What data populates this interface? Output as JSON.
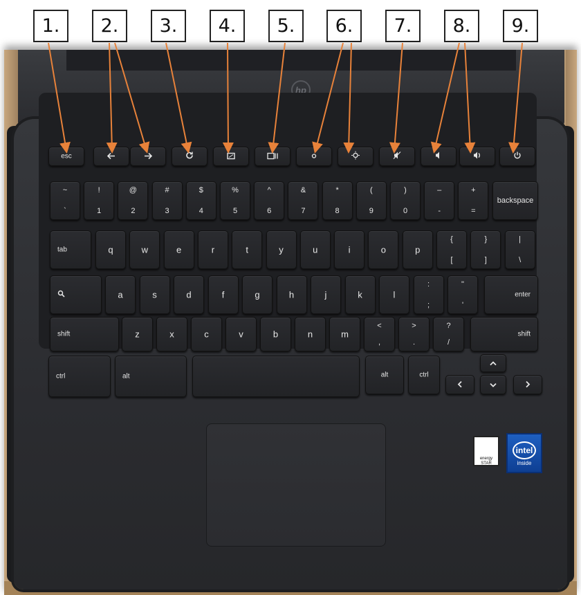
{
  "callouts": [
    "1.",
    "2.",
    "3.",
    "4.",
    "5.",
    "6.",
    "7.",
    "8.",
    "9."
  ],
  "colors": {
    "arrow": "#e8823a",
    "key_text": "#e6e6e6",
    "laptop_body": "#2b2c30"
  },
  "laptop": {
    "lid_logo": "hp",
    "energy_star_label": "energy STAR",
    "intel_logo": "intel",
    "intel_sub": "inside"
  },
  "keys": {
    "top_row": [
      "esc",
      "back-arrow-icon",
      "forward-arrow-icon",
      "refresh-icon",
      "fullscreen-icon",
      "overview-icon",
      "brightness-down-icon",
      "brightness-up-icon",
      "mute-icon",
      "volume-down-icon",
      "volume-up-icon",
      "power-icon"
    ],
    "number_row": [
      {
        "top": "~",
        "bottom": "`"
      },
      {
        "top": "!",
        "bottom": "1"
      },
      {
        "top": "@",
        "bottom": "2"
      },
      {
        "top": "#",
        "bottom": "3"
      },
      {
        "top": "$",
        "bottom": "4"
      },
      {
        "top": "%",
        "bottom": "5"
      },
      {
        "top": "^",
        "bottom": "6"
      },
      {
        "top": "&",
        "bottom": "7"
      },
      {
        "top": "*",
        "bottom": "8"
      },
      {
        "top": "(",
        "bottom": "9"
      },
      {
        "top": ")",
        "bottom": "0"
      },
      {
        "top": "–",
        "bottom": "-"
      },
      {
        "top": "+",
        "bottom": "="
      },
      {
        "label": "backspace"
      }
    ],
    "tab_row": [
      "tab",
      "q",
      "w",
      "e",
      "r",
      "t",
      "y",
      "u",
      "i",
      "o",
      "p",
      {
        "top": "{",
        "bottom": "["
      },
      {
        "top": "}",
        "bottom": "]"
      },
      {
        "top": "|",
        "bottom": "\\"
      }
    ],
    "home_row": [
      "search-icon",
      "a",
      "s",
      "d",
      "f",
      "g",
      "h",
      "j",
      "k",
      "l",
      {
        "top": ":",
        "bottom": ";"
      },
      {
        "top": "\"",
        "bottom": "'"
      },
      "enter"
    ],
    "shift_row": [
      "shift",
      "z",
      "x",
      "c",
      "v",
      "b",
      "n",
      "m",
      {
        "top": "<",
        "bottom": ","
      },
      {
        "top": ">",
        "bottom": "."
      },
      {
        "top": "?",
        "bottom": "/"
      },
      "shift"
    ],
    "bottom_row": [
      "ctrl",
      "alt",
      "",
      "alt",
      "ctrl"
    ],
    "arrow_keys": [
      "up-arrow-icon",
      "left-arrow-icon",
      "down-arrow-icon",
      "right-arrow-icon"
    ]
  }
}
